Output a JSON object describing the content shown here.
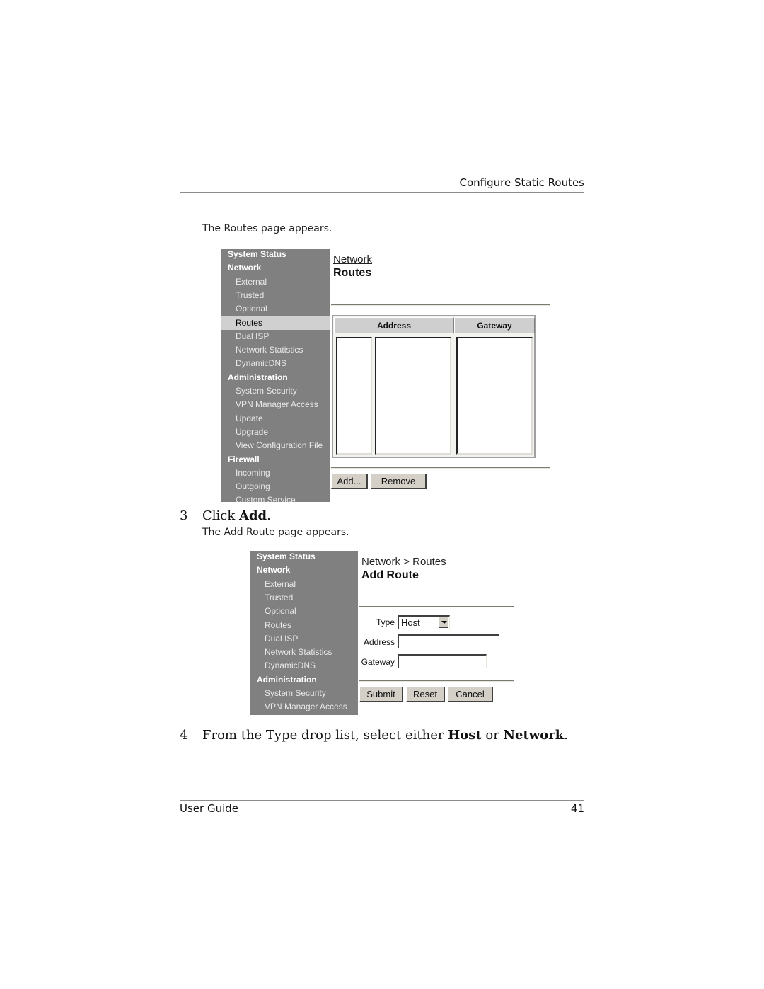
{
  "page": {
    "running_head": "Configure Static Routes",
    "intro_text": "The Routes page appears.",
    "step3": {
      "number": "3",
      "prefix": "Click ",
      "bold": "Add",
      "suffix": "."
    },
    "step3_result": "The Add Route page appears.",
    "step4": {
      "number": "4",
      "prefix": "From the Type drop list, select either ",
      "bold1": "Host",
      "middle": " or ",
      "bold2": "Network",
      "suffix": "."
    },
    "footer_left": "User Guide",
    "footer_page": "41"
  },
  "routes_screen": {
    "sidebar": [
      {
        "label": "System Status",
        "type": "category"
      },
      {
        "label": "Network",
        "type": "category"
      },
      {
        "label": "External",
        "type": "item"
      },
      {
        "label": "Trusted",
        "type": "item"
      },
      {
        "label": "Optional",
        "type": "item"
      },
      {
        "label": "Routes",
        "type": "item",
        "active": true
      },
      {
        "label": "Dual ISP",
        "type": "item"
      },
      {
        "label": "Network Statistics",
        "type": "item"
      },
      {
        "label": "DynamicDNS",
        "type": "item"
      },
      {
        "label": "Administration",
        "type": "category"
      },
      {
        "label": "System Security",
        "type": "item"
      },
      {
        "label": "VPN Manager Access",
        "type": "item"
      },
      {
        "label": "Update",
        "type": "item"
      },
      {
        "label": "Upgrade",
        "type": "item"
      },
      {
        "label": "View Configuration File",
        "type": "item"
      },
      {
        "label": "Firewall",
        "type": "category"
      },
      {
        "label": "Incoming",
        "type": "item"
      },
      {
        "label": "Outgoing",
        "type": "item"
      },
      {
        "label": "Custom Service",
        "type": "item"
      }
    ],
    "breadcrumb": "Network",
    "title": "Routes",
    "table": {
      "columns": [
        "Address",
        "Gateway"
      ]
    },
    "buttons": {
      "add": "Add...",
      "remove": "Remove"
    }
  },
  "add_route_screen": {
    "sidebar": [
      {
        "label": "System Status",
        "type": "category"
      },
      {
        "label": "Network",
        "type": "category"
      },
      {
        "label": "External",
        "type": "item"
      },
      {
        "label": "Trusted",
        "type": "item"
      },
      {
        "label": "Optional",
        "type": "item"
      },
      {
        "label": "Routes",
        "type": "item"
      },
      {
        "label": "Dual ISP",
        "type": "item"
      },
      {
        "label": "Network Statistics",
        "type": "item"
      },
      {
        "label": "DynamicDNS",
        "type": "item"
      },
      {
        "label": "Administration",
        "type": "category"
      },
      {
        "label": "System Security",
        "type": "item"
      },
      {
        "label": "VPN Manager Access",
        "type": "item"
      }
    ],
    "breadcrumb": {
      "first": "Network",
      "separator": " > ",
      "second": "Routes"
    },
    "title": "Add Route",
    "form": {
      "type_label": "Type",
      "type_value": "Host",
      "address_label": "Address",
      "address_value": "",
      "gateway_label": "Gateway",
      "gateway_value": ""
    },
    "buttons": {
      "submit": "Submit",
      "reset": "Reset",
      "cancel": "Cancel"
    }
  },
  "colors": {
    "sidebar_bg": "#808080",
    "sidebar_active": "#d0d0d0",
    "button_face": "#d4d0c8",
    "table_header": "#cfcfcf"
  }
}
